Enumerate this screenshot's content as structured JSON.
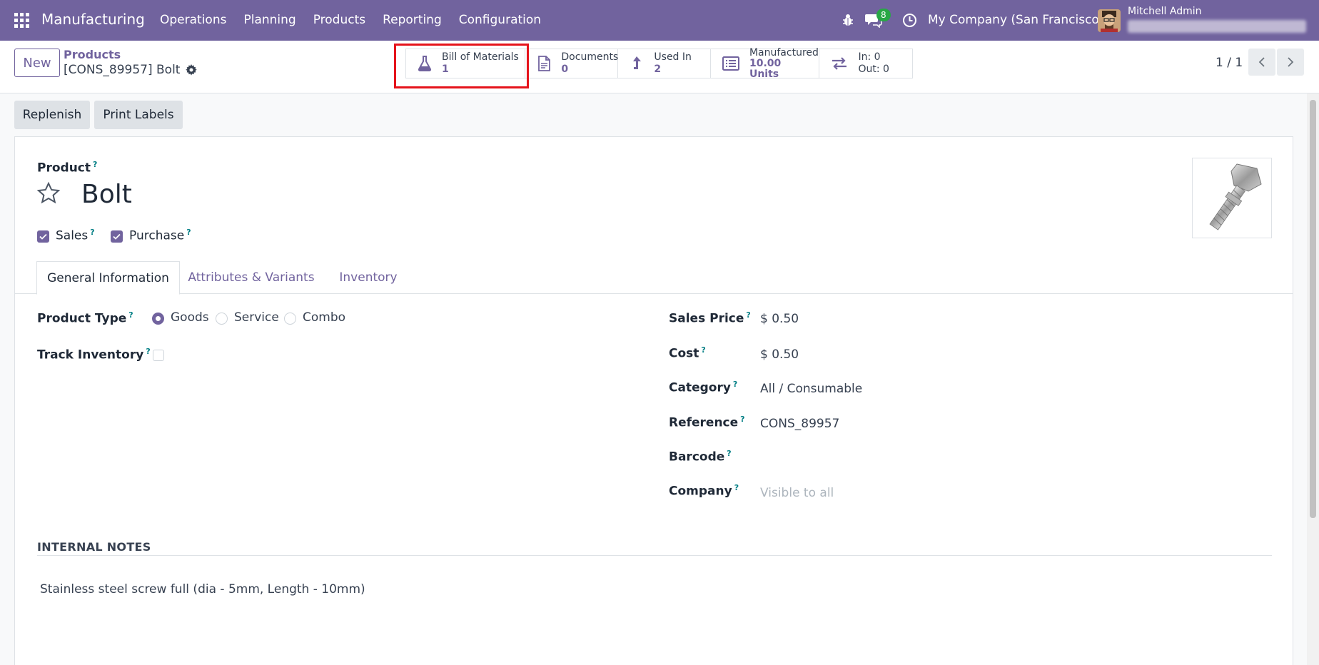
{
  "navbar": {
    "app_name": "Manufacturing",
    "menu": [
      "Operations",
      "Planning",
      "Products",
      "Reporting",
      "Configuration"
    ],
    "chat_badge": "8",
    "company": "My Company (San Francisco)",
    "user_name": "Mitchell Admin"
  },
  "control": {
    "new_label": "New",
    "breadcrumb_parent": "Products",
    "breadcrumb_current": "[CONS_89957] Bolt",
    "stats": [
      {
        "label": "Bill of Materials",
        "value": "1"
      },
      {
        "label": "Documents",
        "value": "0"
      },
      {
        "label": "Used In",
        "value": "2"
      },
      {
        "label": "Manufactured",
        "value": "10.00",
        "unit": "Units"
      },
      {
        "label_in": "In: 0",
        "label_out": "Out: 0"
      }
    ],
    "pager": "1 / 1"
  },
  "actions": {
    "replenish": "Replenish",
    "print_labels": "Print Labels"
  },
  "form": {
    "product_label": "Product",
    "product_name": "Bolt",
    "sales_label": "Sales",
    "purchase_label": "Purchase",
    "tabs": [
      "General Information",
      "Attributes & Variants",
      "Inventory"
    ],
    "product_type_label": "Product Type",
    "product_type_options": [
      "Goods",
      "Service",
      "Combo"
    ],
    "track_inventory_label": "Track Inventory",
    "sales_price_label": "Sales Price",
    "sales_price": "$ 0.50",
    "cost_label": "Cost",
    "cost": "$ 0.50",
    "category_label": "Category",
    "category": "All / Consumable",
    "reference_label": "Reference",
    "reference": "CONS_89957",
    "barcode_label": "Barcode",
    "company_label": "Company",
    "company_placeholder": "Visible to all",
    "notes_title": "INTERNAL NOTES",
    "notes_text": "Stainless steel screw full (dia - 5mm, Length - 10mm)"
  },
  "colors": {
    "brand": "#71639e",
    "highlight": "#e5131b",
    "badge": "#28a745"
  }
}
